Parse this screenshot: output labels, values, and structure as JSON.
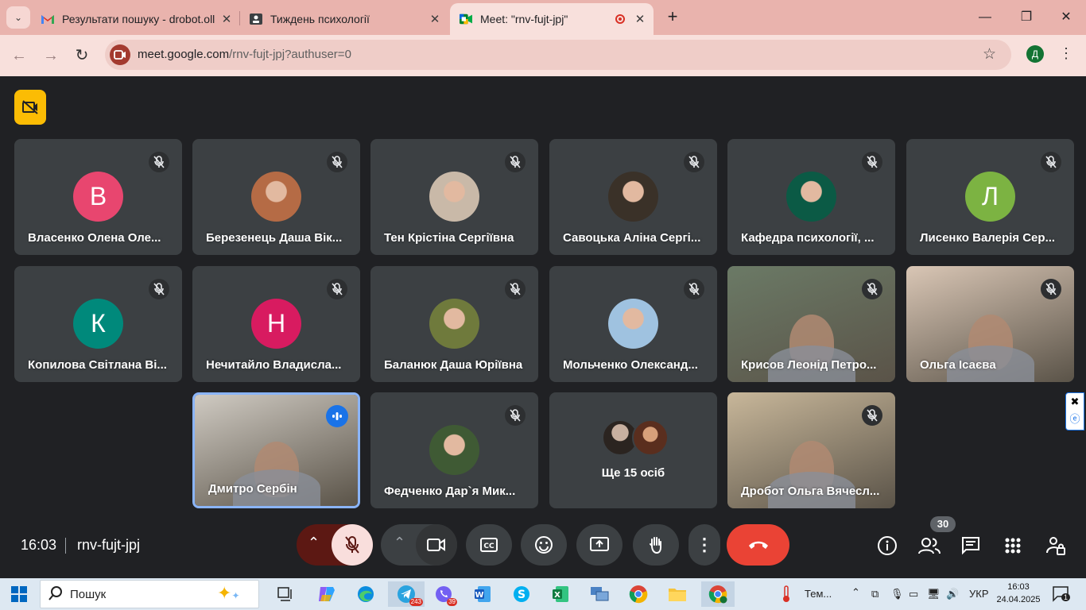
{
  "browser": {
    "tabs": [
      {
        "title": "Результати пошуку - drobot.oll",
        "icon": "gmail-icon"
      },
      {
        "title": "Тиждень психології",
        "icon": "classroom-icon"
      },
      {
        "title": "Meet: \"rnv-fujt-jpj\"",
        "icon": "meet-icon",
        "active": true
      }
    ],
    "new_tab": "+",
    "url_host": "meet.google.com",
    "url_path": "/rnv-fujt-jpj?authuser=0",
    "profile_initial": "Д"
  },
  "meet": {
    "tiles": [
      {
        "name": "Власенко Олена Оле...",
        "initial": "В",
        "color": "#e8466f",
        "muted": true
      },
      {
        "name": "Березенець Даша Вік...",
        "photo": "#b56b45",
        "muted": true
      },
      {
        "name": "Тен Крістіна Сергіївна",
        "photo": "#c9b9a8",
        "muted": true
      },
      {
        "name": "Савоцька Аліна Сергі...",
        "photo": "#3a3128",
        "muted": true
      },
      {
        "name": "Кафедра психології, ...",
        "photo": "#0b5a45",
        "muted": true
      },
      {
        "name": "Лисенко Валерія Сер...",
        "initial": "Л",
        "color": "#7cb342",
        "muted": true
      },
      {
        "name": "Копилова Світлана Ві...",
        "initial": "К",
        "color": "#00897b",
        "muted": true
      },
      {
        "name": "Нечитайло Владисла...",
        "initial": "Н",
        "color": "#d81b60",
        "muted": true
      },
      {
        "name": "Баланюк Даша Юріївна",
        "photo": "#6f7a3c",
        "muted": true
      },
      {
        "name": "Мольченко Олександ...",
        "photo": "#9fc2e0",
        "muted": true
      },
      {
        "name": "Крисов Леонід Петро...",
        "video": "#6b7a66",
        "muted": true
      },
      {
        "name": "Ольга Ісаєва",
        "video": "#d9c6b5",
        "muted": true
      },
      {
        "name": "Дмитро Сербін",
        "video": "#cfcac2",
        "speaking": true
      },
      {
        "name": "Федченко Дар`я Мик...",
        "photo": "#3f5a34",
        "muted": true
      },
      {
        "more": "Ще 15 осіб"
      },
      {
        "name": "Дробот Ольга Вячесл...",
        "video": "#c8b79a",
        "muted": true
      }
    ],
    "clock": "16:03",
    "meeting_code": "rnv-fujt-jpj",
    "participant_count": "30"
  },
  "taskbar": {
    "search_label": "Пошук",
    "weather": "Тем...",
    "lang": "УКР",
    "time": "16:03",
    "date": "24.04.2025",
    "telegram_count": "243",
    "viber_count": "39",
    "notif_count": "1"
  }
}
